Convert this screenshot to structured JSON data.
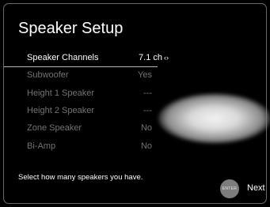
{
  "screen": {
    "title": "Speaker Setup",
    "hint": "Select how many speakers you have."
  },
  "settings": [
    {
      "label": "Speaker Channels",
      "value": "7.1 ch",
      "selected": true,
      "arrows": "‹›"
    },
    {
      "label": "Subwoofer",
      "value": "Yes"
    },
    {
      "label": "Height 1 Speaker",
      "value": "---"
    },
    {
      "label": "Height 2 Speaker",
      "value": "---"
    },
    {
      "label": "Zone Speaker",
      "value": "No"
    },
    {
      "label": "Bi-Amp",
      "value": "No"
    }
  ],
  "footer": {
    "enter_label": "ENTER",
    "next_label": "Next"
  },
  "colors": {
    "background": "#000000",
    "text_active": "#ffffff",
    "text_inactive": "#747474",
    "enter_button": "#7c7c7c"
  }
}
